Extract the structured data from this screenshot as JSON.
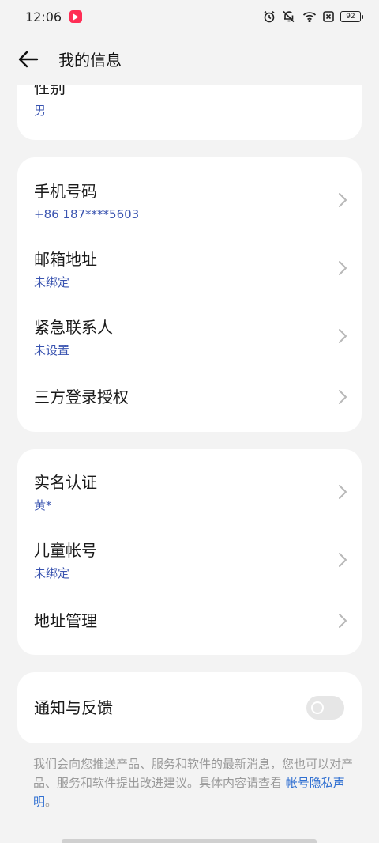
{
  "status_bar": {
    "time": "12:06",
    "battery": "92"
  },
  "header": {
    "title": "我的信息"
  },
  "top_card": {
    "title": "性别",
    "value": "男"
  },
  "contact_card": {
    "items": [
      {
        "title": "手机号码",
        "value": "+86 187****5603"
      },
      {
        "title": "邮箱地址",
        "value": "未绑定"
      },
      {
        "title": "紧急联系人",
        "value": "未设置"
      },
      {
        "title": "三方登录授权"
      }
    ]
  },
  "identity_card": {
    "items": [
      {
        "title": "实名认证",
        "value": "黄*"
      },
      {
        "title": "儿童帐号",
        "value": "未绑定"
      },
      {
        "title": "地址管理"
      }
    ]
  },
  "notify_card": {
    "title": "通知与反馈",
    "toggle_on": false
  },
  "footnote": {
    "text": "我们会向您推送产品、服务和软件的最新消息，您也可以对产品、服务和软件提出改进建议。具体内容请查看 ",
    "link": "帐号隐私声明",
    "end": "。"
  },
  "colors": {
    "accent_text": "#3a54b0",
    "link": "#2f6fd1",
    "app_badge": "#ff2d55"
  }
}
